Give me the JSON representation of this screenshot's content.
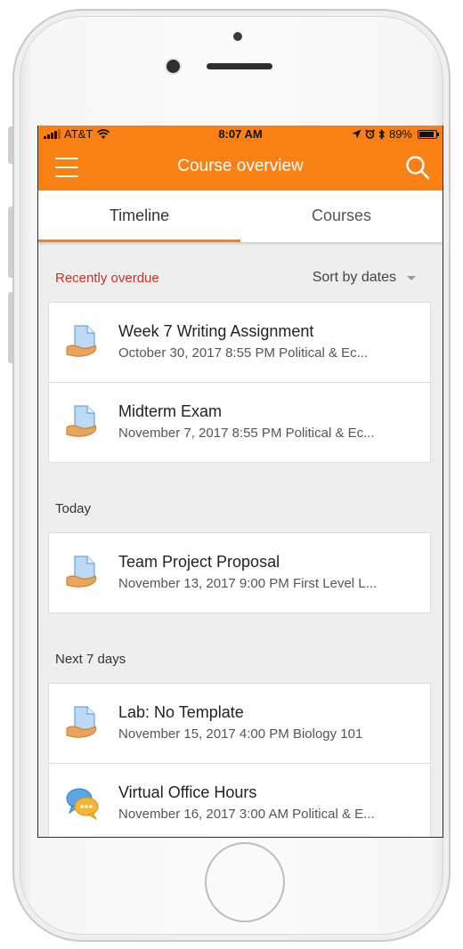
{
  "status_bar": {
    "carrier": "AT&T",
    "time": "8:07 AM",
    "battery": "89%",
    "battery_level": 0.89,
    "icons": [
      "signal-icon",
      "wifi-icon",
      "location-icon",
      "alarm-icon",
      "bluetooth-icon",
      "battery-icon"
    ]
  },
  "header": {
    "title": "Course overview",
    "menu_icon": "hamburger-menu-icon",
    "search_icon": "search-icon",
    "color": "#f98012"
  },
  "tabs": [
    {
      "label": "Timeline",
      "active": true
    },
    {
      "label": "Courses",
      "active": false
    }
  ],
  "sort": {
    "label": "Sort by dates"
  },
  "sections": {
    "overdue": {
      "title": "Recently overdue",
      "color": "#ca3120",
      "items": [
        {
          "title": "Week 7 Writing Assignment",
          "subtitle": "October 30, 2017 8:55 PM Political & Ec...",
          "icon": "assignment-icon"
        },
        {
          "title": "Midterm Exam",
          "subtitle": "November 7, 2017 8:55 PM Political & Ec...",
          "icon": "assignment-icon"
        }
      ]
    },
    "today": {
      "title": "Today",
      "items": [
        {
          "title": "Team Project Proposal",
          "subtitle": "November 13, 2017 9:00 PM First Level L...",
          "icon": "assignment-icon"
        }
      ]
    },
    "next7": {
      "title": "Next 7 days",
      "items": [
        {
          "title": "Lab: No Template",
          "subtitle": "November 15, 2017 4:00 PM Biology 101",
          "icon": "assignment-icon"
        },
        {
          "title": "Virtual Office Hours",
          "subtitle": "November 16, 2017 3:00 AM Political & E...",
          "icon": "chat-icon"
        }
      ]
    }
  }
}
